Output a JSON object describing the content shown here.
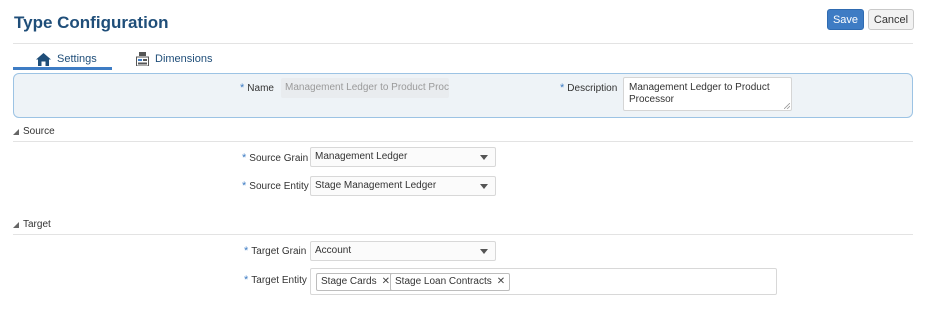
{
  "header": {
    "title": "Type Configuration"
  },
  "toolbar": {
    "save_label": "Save",
    "cancel_label": "Cancel"
  },
  "tabs": [
    {
      "label": "Settings",
      "icon": "home-icon",
      "active": true
    },
    {
      "label": "Dimensions",
      "icon": "dimensions-icon",
      "active": false
    }
  ],
  "general": {
    "name_label": "Name",
    "name_value": "Management Ledger to Product Proces",
    "description_label": "Description",
    "description_value": "Management Ledger to Product Processor"
  },
  "source": {
    "heading": "Source",
    "grain_label": "Source Grain",
    "grain_value": "Management Ledger",
    "entity_label": "Source Entity",
    "entity_value": "Stage Management Ledger"
  },
  "target": {
    "heading": "Target",
    "grain_label": "Target Grain",
    "grain_value": "Account",
    "entity_label": "Target Entity",
    "entity_chips": [
      "Stage Cards",
      "Stage Loan Contracts"
    ]
  },
  "colors": {
    "accent": "#3e7cc4",
    "title": "#1f4e79",
    "panel_bg": "#eef3f7",
    "panel_border": "#9cc3e4"
  }
}
